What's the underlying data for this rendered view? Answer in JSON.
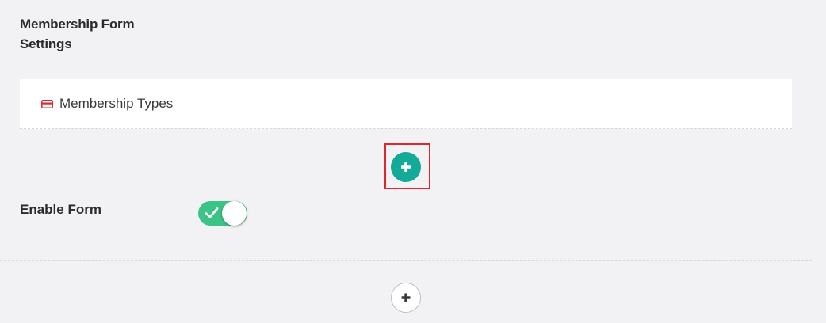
{
  "settings": {
    "title": "Membership Form Settings"
  },
  "membership_types": {
    "icon": "credit-card-icon",
    "icon_color": "#e0262c",
    "label": "Membership Types"
  },
  "add_button": {
    "icon": "plus-icon",
    "color": "#13aa99",
    "highlight_color": "#e0262c"
  },
  "enable_form": {
    "label": "Enable Form",
    "enabled": true,
    "toggle_color": "#3cc386",
    "icon": "checkmark-icon"
  },
  "add_section_button": {
    "icon": "plus-icon"
  }
}
